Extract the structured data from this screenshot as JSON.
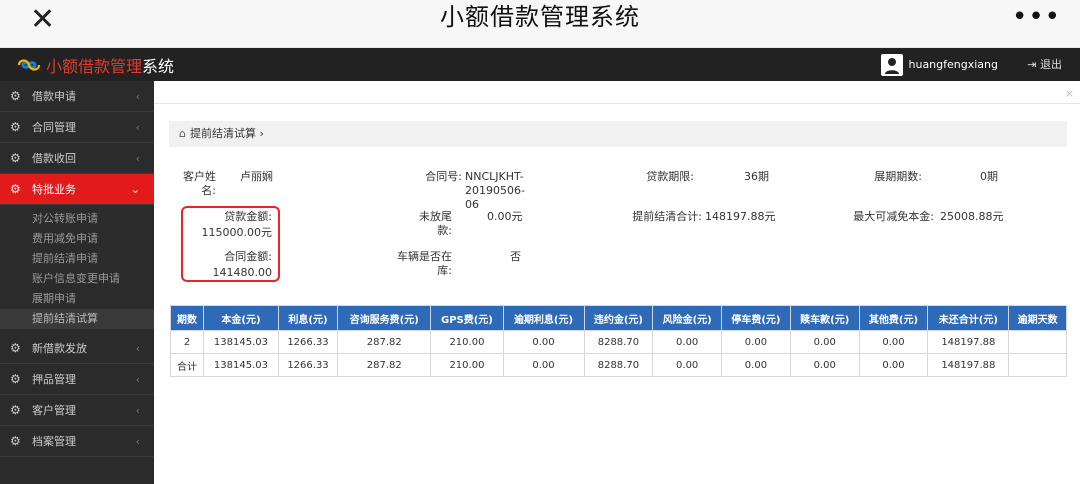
{
  "window": {
    "title": "小额借款管理系统",
    "close_icon": "close-icon",
    "more_icon": "more-icon"
  },
  "app": {
    "brand_red": "小额借款管理",
    "brand_white": "系统",
    "username": "huangfengxiang",
    "logout": "退出"
  },
  "sidebar": {
    "items": [
      {
        "label": "借款申请",
        "active": false
      },
      {
        "label": "合同管理",
        "active": false
      },
      {
        "label": "借款收回",
        "active": false
      },
      {
        "label": "特批业务",
        "active": true
      },
      {
        "label": "新借款发放",
        "active": false
      },
      {
        "label": "押品管理",
        "active": false
      },
      {
        "label": "客户管理",
        "active": false
      },
      {
        "label": "档案管理",
        "active": false
      }
    ],
    "submenu": [
      "对公转账申请",
      "费用减免申请",
      "提前结清申请",
      "账户信息变更申请",
      "展期申请",
      "提前结清试算"
    ]
  },
  "breadcrumb": {
    "label": "提前结清试算",
    "sep": "›"
  },
  "summary": {
    "customer_label": "客户姓名:",
    "customer_value": "卢丽娴",
    "contract_no_label": "合同号:",
    "contract_no_value": "NNCLJKHT-20190506-06",
    "loan_term_label": "贷款期限:",
    "loan_term_value": "36期",
    "ext_term_label": "展期期数:",
    "ext_term_value": "0期",
    "loan_amount_label": "贷款金额:",
    "loan_amount_value": "115000.00元",
    "unpaid_tail_label": "未放尾款:",
    "unpaid_tail_value": "0.00元",
    "early_total_label": "提前结清合计:",
    "early_total_value": "148197.88元",
    "max_reduce_label": "最大可减免本金:",
    "max_reduce_value": "25008.88元",
    "contract_amount_label": "合同金额:",
    "contract_amount_value": "141480.00",
    "vehicle_label": "车辆是否在库:",
    "vehicle_value": "否"
  },
  "table": {
    "headers": [
      "期数",
      "本金(元)",
      "利息(元)",
      "咨询服务费(元)",
      "GPS费(元)",
      "逾期利息(元)",
      "违约金(元)",
      "风险金(元)",
      "停车费(元)",
      "赎车款(元)",
      "其他费(元)",
      "未还合计(元)",
      "逾期天数"
    ],
    "rows": [
      [
        "2",
        "138145.03",
        "1266.33",
        "287.82",
        "210.00",
        "0.00",
        "8288.70",
        "0.00",
        "0.00",
        "0.00",
        "0.00",
        "148197.88",
        ""
      ],
      [
        "合计",
        "138145.03",
        "1266.33",
        "287.82",
        "210.00",
        "0.00",
        "8288.70",
        "0.00",
        "0.00",
        "0.00",
        "0.00",
        "148197.88",
        ""
      ]
    ]
  },
  "colors": {
    "accent_red": "#e11b1b",
    "table_header": "#2f6ab8",
    "sidebar_bg": "#2b2b2b"
  }
}
